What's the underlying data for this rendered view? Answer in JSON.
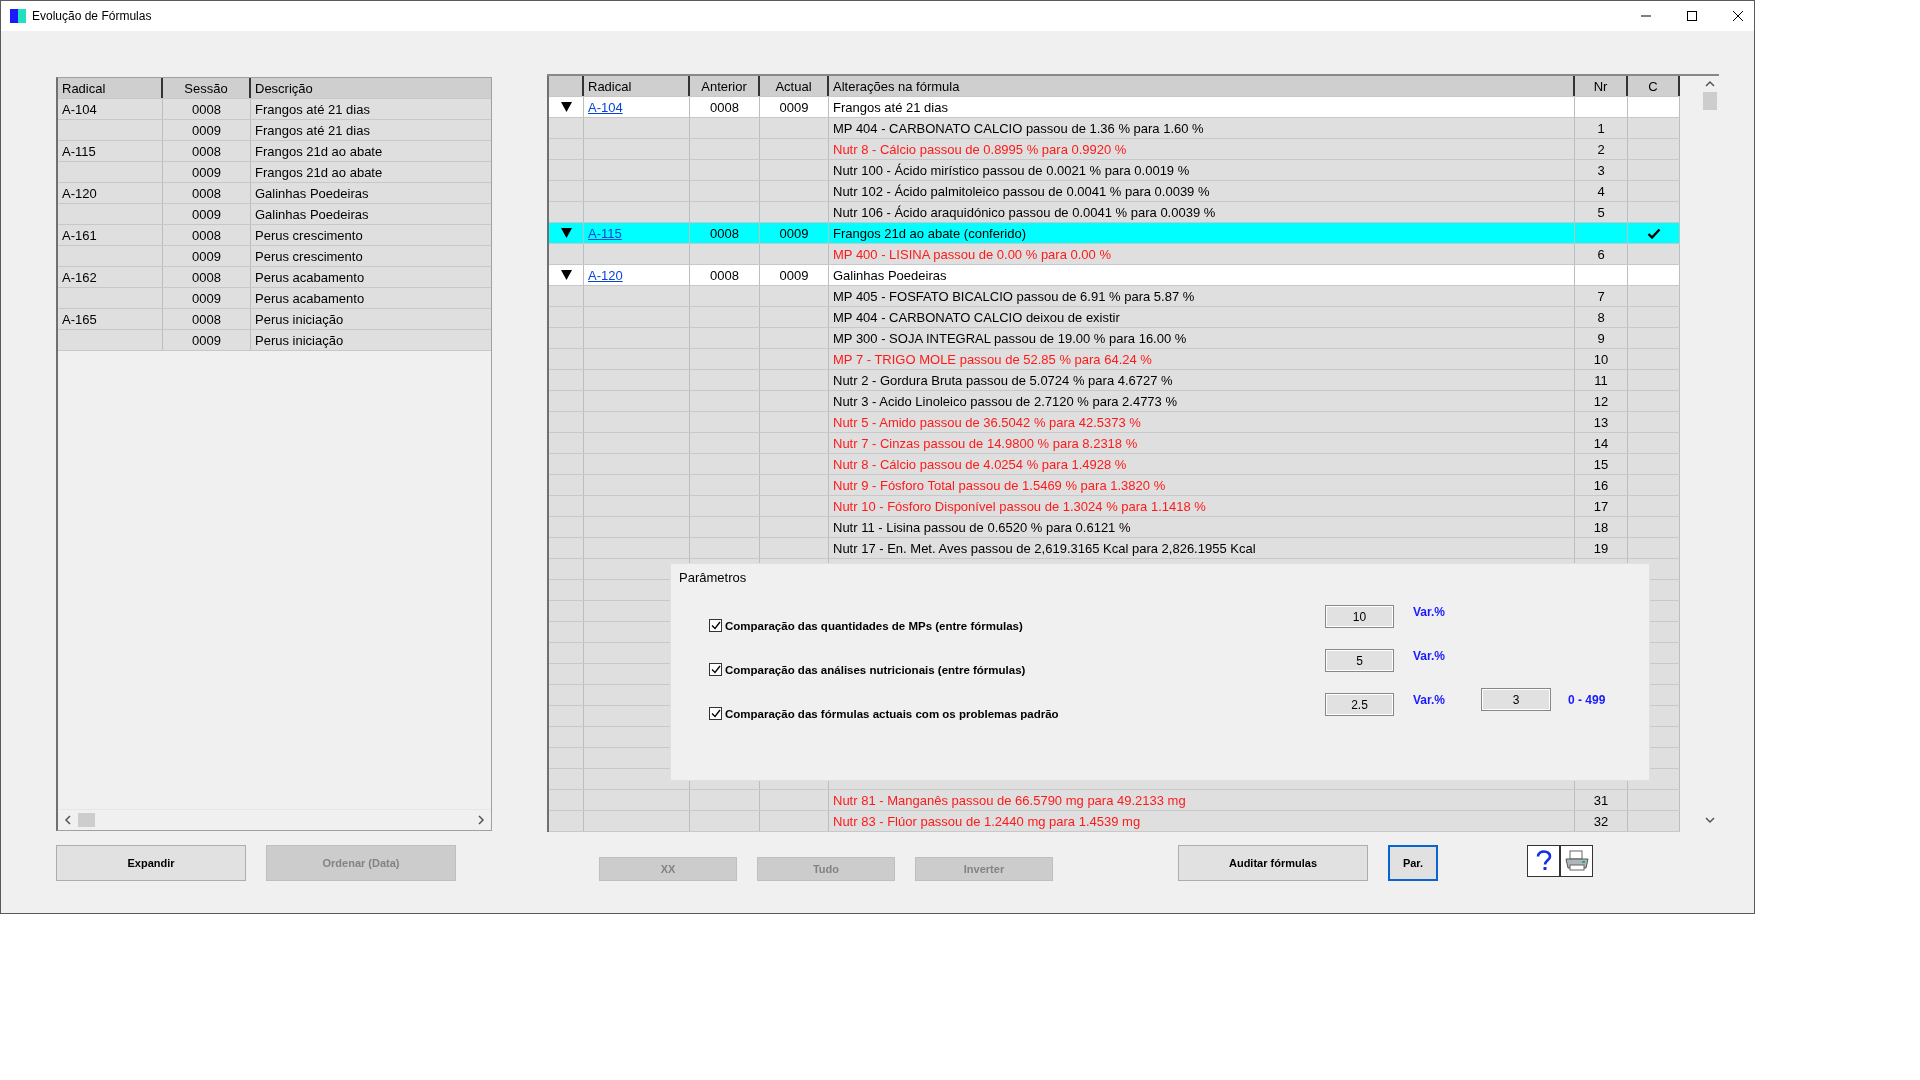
{
  "window": {
    "title": "Evolução de Fórmulas"
  },
  "left_table": {
    "columns": [
      "Radical",
      "Sessão",
      "Descrição"
    ],
    "rows": [
      {
        "radical": "A-104",
        "session": "0008",
        "description": "Frangos até 21 dias"
      },
      {
        "session": "0009",
        "description": "Frangos até 21 dias"
      },
      {
        "radical": "A-115",
        "session": "0008",
        "description": "Frangos 21d ao abate"
      },
      {
        "session": "0009",
        "description": "Frangos 21d ao abate"
      },
      {
        "radical": "A-120",
        "session": "0008",
        "description": "Galinhas Poedeiras"
      },
      {
        "session": "0009",
        "description": "Galinhas Poedeiras"
      },
      {
        "radical": "A-161",
        "session": "0008",
        "description": "Perus crescimento"
      },
      {
        "session": "0009",
        "description": "Perus crescimento"
      },
      {
        "radical": "A-162",
        "session": "0008",
        "description": "Perus acabamento"
      },
      {
        "session": "0009",
        "description": "Perus acabamento"
      },
      {
        "radical": "A-165",
        "session": "0008",
        "description": "Perus iniciação"
      },
      {
        "session": "0009",
        "description": "Perus iniciação"
      }
    ]
  },
  "right_table": {
    "columns": [
      "Radical",
      "Anterior",
      "Actual",
      "Alterações na fórmula",
      "Nr",
      "C"
    ],
    "rows": [
      {
        "kind": "group",
        "radical": "A-104",
        "previous": "0008",
        "current": "0009",
        "description": "Frangos até 21 dias",
        "expanded": true,
        "selected": false,
        "checked": false
      },
      {
        "kind": "change",
        "text": "MP 404 - CARBONATO CALCIO passou de 1.36 % para 1.60 %",
        "nr": "1",
        "alert": false
      },
      {
        "kind": "change",
        "text": "Nutr 8 - Cálcio passou de  0.8995 % para 0.9920 %",
        "nr": "2",
        "alert": true
      },
      {
        "kind": "change",
        "text": "Nutr 100 - Ácido mirístico passou de  0.0021 % para 0.0019 %",
        "nr": "3",
        "alert": false
      },
      {
        "kind": "change",
        "text": "Nutr 102 - Ácido palmitoleico passou de  0.0041 % para 0.0039 %",
        "nr": "4",
        "alert": false
      },
      {
        "kind": "change",
        "text": "Nutr 106 - Ácido araquidónico passou de  0.0041 % para 0.0039 %",
        "nr": "5",
        "alert": false
      },
      {
        "kind": "group",
        "radical": "A-115",
        "previous": "0008",
        "current": "0009",
        "description": "Frangos 21d ao abate (conferido)",
        "expanded": true,
        "selected": true,
        "checked": true
      },
      {
        "kind": "change",
        "text": "MP 400 - LISINA passou de 0.00 % para 0.00 %",
        "nr": "6",
        "alert": true
      },
      {
        "kind": "group",
        "radical": "A-120",
        "previous": "0008",
        "current": "0009",
        "description": "Galinhas Poedeiras",
        "expanded": true,
        "selected": false,
        "checked": false
      },
      {
        "kind": "change",
        "text": "MP 405 - FOSFATO BICALCIO passou de 6.91 % para 5.87 %",
        "nr": "7",
        "alert": false
      },
      {
        "kind": "change",
        "text": "MP 404 - CARBONATO CALCIO deixou de existir",
        "nr": "8",
        "alert": false
      },
      {
        "kind": "change",
        "text": "MP 300 - SOJA INTEGRAL passou de 19.00 % para 16.00 %",
        "nr": "9",
        "alert": false
      },
      {
        "kind": "change",
        "text": "MP 7 - TRIGO MOLE passou de 52.85 % para 64.24 %",
        "nr": "10",
        "alert": true
      },
      {
        "kind": "change",
        "text": "Nutr 2 - Gordura Bruta passou de  5.0724 % para 4.6727 %",
        "nr": "11",
        "alert": false
      },
      {
        "kind": "change",
        "text": "Nutr 3 - Acido Linoleico passou de  2.7120 % para 2.4773 %",
        "nr": "12",
        "alert": false
      },
      {
        "kind": "change",
        "text": "Nutr 5 - Amido passou de  36.5042 % para 42.5373 %",
        "nr": "13",
        "alert": true
      },
      {
        "kind": "change",
        "text": "Nutr 7 - Cinzas passou de  14.9800 % para 8.2318 %",
        "nr": "14",
        "alert": true
      },
      {
        "kind": "change",
        "text": "Nutr 8 - Cálcio passou de  4.0254 % para 1.4928 %",
        "nr": "15",
        "alert": true
      },
      {
        "kind": "change",
        "text": "Nutr 9 - Fósforo Total passou de  1.5469 % para 1.3820 %",
        "nr": "16",
        "alert": true
      },
      {
        "kind": "change",
        "text": "Nutr 10 - Fósforo Disponível passou de  1.3024 % para 1.1418 %",
        "nr": "17",
        "alert": true
      },
      {
        "kind": "change",
        "text": "Nutr 11 - Lisina passou de  0.6520 % para 0.6121 %",
        "nr": "18",
        "alert": false
      },
      {
        "kind": "change",
        "text": "Nutr 17 - En. Met. Aves passou de  2,619.3165 Kcal para 2,826.1955 Kcal",
        "nr": "19",
        "alert": false
      }
    ],
    "rows_below_panel": [
      {
        "text": "Nutr 81 - Manganês passou de  66.5790 mg para 49.2133 mg",
        "nr": "31",
        "alert": true
      },
      {
        "text": "Nutr 83 - Flúor passou de  1.2440 mg para 1.4539 mg",
        "nr": "32",
        "alert": true
      }
    ]
  },
  "parameters": {
    "title": "Parâmetros",
    "options": [
      {
        "label": "Comparação das quantidades de MPs (entre fórmulas)",
        "checked": true,
        "value": "10",
        "unit": "Var.%"
      },
      {
        "label": "Comparação das análises nutricionais (entre fórmulas)",
        "checked": true,
        "value": "5",
        "unit": "Var.%"
      },
      {
        "label": "Comparação das fórmulas actuais com os problemas padrão",
        "checked": true,
        "value": "2.5",
        "unit": "Var.%",
        "extra_value": "3",
        "range": "0 - 499"
      }
    ]
  },
  "left_buttons": [
    {
      "label": "Expandir",
      "disabled": false
    },
    {
      "label": "Ordenar (Data)",
      "disabled": true
    }
  ],
  "center_buttons": [
    {
      "label": "XX",
      "disabled": true
    },
    {
      "label": "Tudo",
      "disabled": true
    },
    {
      "label": "Inverter",
      "disabled": true
    }
  ],
  "right_buttons": [
    {
      "label": "Auditar fórmulas",
      "focused": false
    },
    {
      "label": "Par.",
      "focused": true
    }
  ]
}
